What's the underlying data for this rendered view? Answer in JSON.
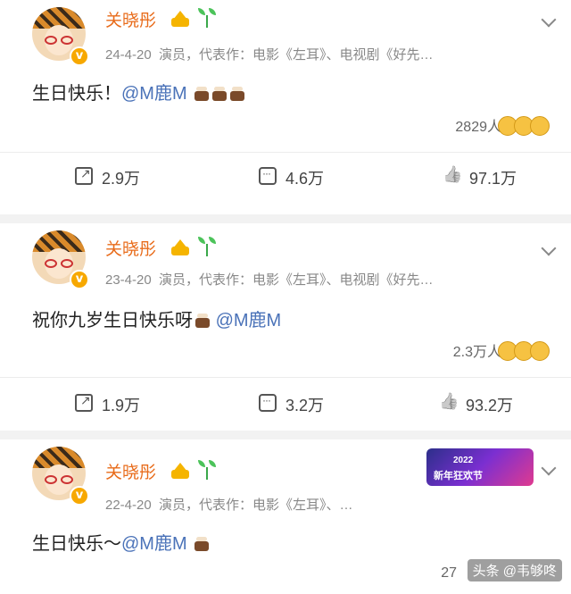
{
  "posts": [
    {
      "user": "关晓彤",
      "date": "24-4-20",
      "bio": "演员，代表作：电影《左耳》、电视剧《好先…",
      "text_before": "生日快乐！",
      "mention": "@M鹿M",
      "text_after": "",
      "cakes": 3,
      "likes_count": "2829人",
      "share": "2.9万",
      "comment": "4.6万",
      "like": "97.1万"
    },
    {
      "user": "关晓彤",
      "date": "23-4-20",
      "bio": "演员，代表作：电影《左耳》、电视剧《好先…",
      "text_before": "祝你九岁生日快乐呀",
      "mention": "@M鹿M",
      "text_after": "",
      "cakes": 1,
      "likes_count": "2.3万人",
      "share": "1.9万",
      "comment": "3.2万",
      "like": "93.2万"
    },
    {
      "user": "关晓彤",
      "date": "22-4-20",
      "bio": "演员，代表作：电影《左耳》、…",
      "text_before": "生日快乐～",
      "mention": "@M鹿M",
      "text_after": "",
      "cakes": 1,
      "banner_year": "2022",
      "banner_text": "新年狂欢节"
    }
  ],
  "watermark": {
    "count_fragment": "27",
    "text": "头条 @韦够咚"
  },
  "icons": {
    "verified": "verified-badge-icon",
    "crown": "crown-icon",
    "sprout": "sprout-icon",
    "more": "chevron-down-icon",
    "share": "share-icon",
    "comment": "comment-icon",
    "like": "thumbs-up-icon",
    "cake": "cake-icon"
  },
  "colors": {
    "username": "#e86b1a",
    "mention": "#4a72b8",
    "meta": "#888888"
  }
}
